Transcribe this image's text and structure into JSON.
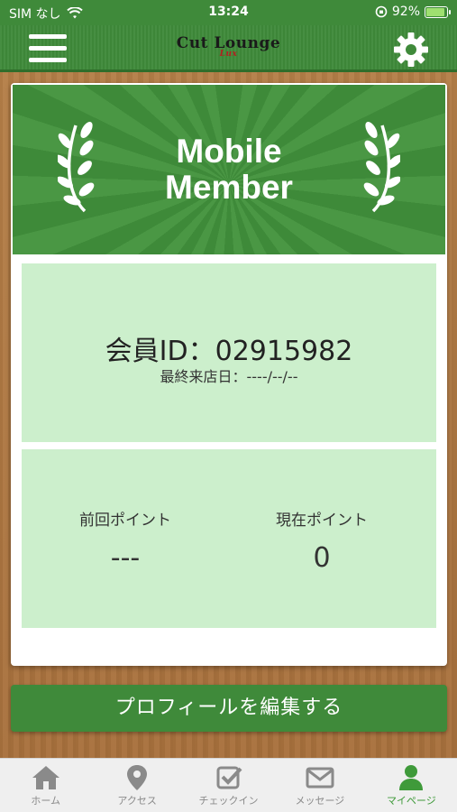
{
  "status_bar": {
    "carrier": "SIM なし",
    "time": "13:24",
    "battery": "92%",
    "battery_level": 0.92
  },
  "header": {
    "logo_main": "Cut Lounge",
    "logo_sub": "Lux"
  },
  "banner": {
    "title_line1": "Mobile",
    "title_line2": "Member"
  },
  "member": {
    "id_text": "会員ID：02915982",
    "last_visit": "最終来店日：----/--/--"
  },
  "points": {
    "previous_label": "前回ポイント",
    "previous_value": "---",
    "current_label": "現在ポイント",
    "current_value": "0"
  },
  "edit_profile_label": "プロフィールを編集する",
  "tabs": [
    {
      "label": "ホーム",
      "icon": "home-icon"
    },
    {
      "label": "アクセス",
      "icon": "map-pin-icon"
    },
    {
      "label": "チェックイン",
      "icon": "checkbox-icon"
    },
    {
      "label": "メッセージ",
      "icon": "mail-icon"
    },
    {
      "label": "マイページ",
      "icon": "user-icon"
    }
  ],
  "colors": {
    "primary_green": "#3f8a3a",
    "panel_green": "#ccefcc",
    "active_tab": "#3f9a3a"
  }
}
